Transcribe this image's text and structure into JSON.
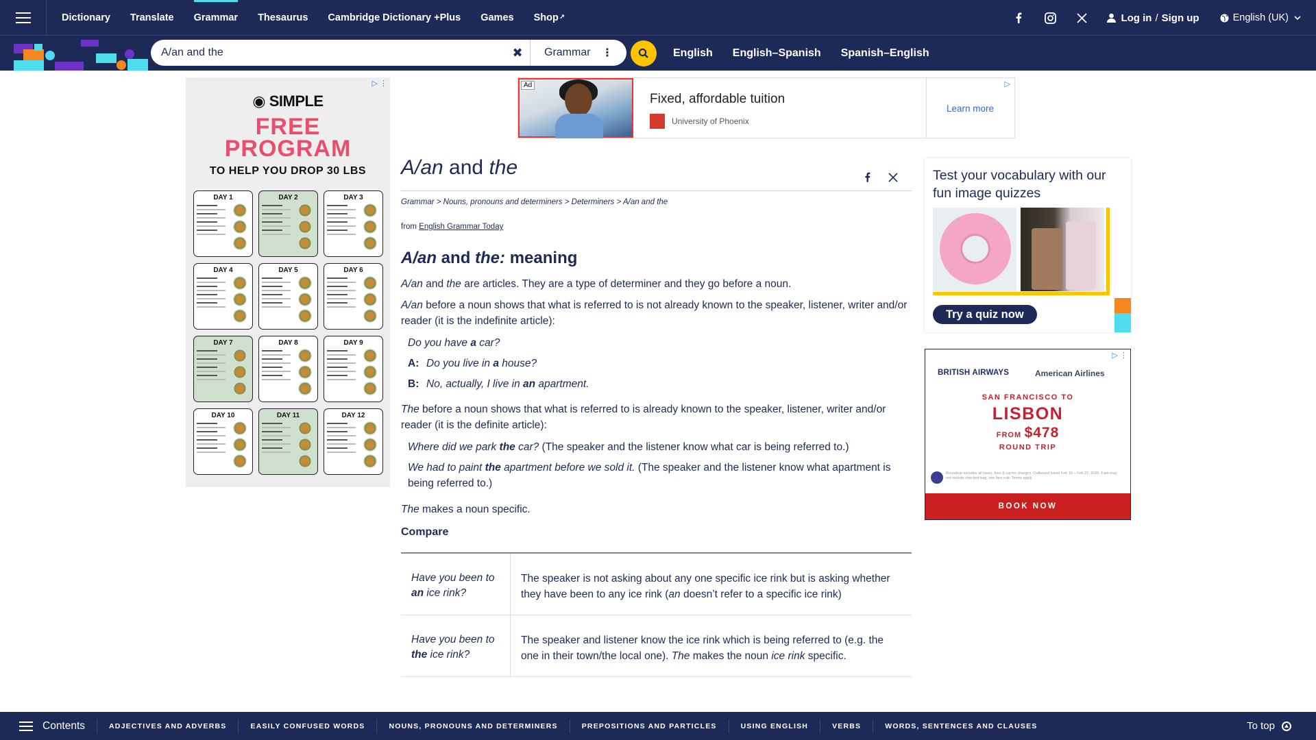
{
  "topnav": {
    "links": [
      {
        "label": "Dictionary"
      },
      {
        "label": "Translate"
      },
      {
        "label": "Grammar",
        "active": true
      },
      {
        "label": "Thesaurus"
      },
      {
        "label": "Cambridge Dictionary +Plus"
      },
      {
        "label": "Games"
      },
      {
        "label": "Shop"
      }
    ],
    "social": [
      "facebook-icon",
      "instagram-icon",
      "x-icon"
    ],
    "login_label": "Log in",
    "signup_label": "Sign up",
    "login_sep": "/",
    "language": "English (UK)"
  },
  "search": {
    "query": "A/an and the",
    "scope": "Grammar",
    "dictionaries": [
      "English",
      "English–Spanish",
      "Spanish–English"
    ]
  },
  "colors": {
    "navy": "#1d2a57",
    "accent_yellow": "#fec400",
    "accent_cyan": "#4fdcec",
    "accent_orange": "#f6861f",
    "accent_purple": "#6c33c6"
  },
  "left_ad": {
    "brand": "SIMPLE",
    "headline_1": "FREE",
    "headline_2": "PROGRAM",
    "subline": "TO HELP YOU DROP 30 LBS",
    "days": [
      "DAY 1",
      "DAY 2",
      "DAY 3",
      "DAY 4",
      "DAY 5",
      "DAY 6",
      "DAY 7",
      "DAY 8",
      "DAY 9",
      "DAY 10",
      "DAY 11",
      "DAY 12"
    ]
  },
  "top_ad": {
    "tag": "Ad",
    "headline": "Fixed, affordable tuition",
    "sponsor": "University of Phoenix",
    "cta": "Learn more"
  },
  "article": {
    "title_em1": "A/an",
    "title_mid": " and ",
    "title_em2": "the",
    "breadcrumb": "Grammar > Nouns, pronouns and determiners > Determiners > A/an and the",
    "from_label": "from ",
    "from_link": "English Grammar Today",
    "h2_em": "A/an",
    "h2_mid": " and ",
    "h2_em2": "the:",
    "h2_rest": " meaning",
    "p1_em1": "A/an",
    "p1_mid": " and ",
    "p1_em2": "the",
    "p1_rest": " are articles. They are a type of determiner and they go before a noun.",
    "p2_em": "A/an",
    "p2_rest": " before a noun shows that what is referred to is not already known to the speaker, listener, writer and/or reader (it is the indefinite article):",
    "ex1_a": "Do you have ",
    "ex1_b": "a",
    "ex1_c": " car?",
    "ex2_spk": "A:",
    "ex2_a": "Do you live in ",
    "ex2_b": "a",
    "ex2_c": " house?",
    "ex3_spk": "B:",
    "ex3_a": "No, actually, I live in ",
    "ex3_b": "an",
    "ex3_c": " apartment.",
    "p3_em": "The",
    "p3_rest": " before a noun shows that what is referred to is already known to the speaker, listener, writer and/or reader (it is the definite article):",
    "ex4_a": "Where did we park ",
    "ex4_b": "the",
    "ex4_c": " car?",
    "ex4_note": " (The speaker and the listener know what car is being referred to.)",
    "ex5_a": "We had to paint ",
    "ex5_b": "the",
    "ex5_c": " apartment before we sold it.",
    "ex5_note": " (The speaker and the listener know what apartment is being referred to.)",
    "p4_em": "The",
    "p4_rest": " makes a noun specific.",
    "compare": "Compare",
    "table": [
      {
        "q_a": "Have you been to ",
        "q_b": "an",
        "q_c": " ice rink?",
        "exp_a": "The speaker is not asking about any one specific ice rink but is asking whether they have been to any ice rink (",
        "exp_em": "an",
        "exp_b": " doesn’t refer to a specific ice rink)"
      },
      {
        "q_a": "Have you been to ",
        "q_b": "the",
        "q_c": " ice rink?",
        "exp_a": "The speaker and listener know the ice rink which is being referred to (e.g. the one in their town/the local one). ",
        "exp_em": "The",
        "exp_b": " makes the noun ",
        "exp_em2": "ice rink",
        "exp_c": " specific."
      }
    ]
  },
  "quiz": {
    "text": "Test your vocabulary with our fun image quizzes",
    "button": "Try a quiz now"
  },
  "ba_ad": {
    "brand1": "BRITISH AIRWAYS",
    "brand2": "American Airlines",
    "route": "SAN FRANCISCO TO",
    "city": "LISBON",
    "from": "FROM",
    "price": "$478",
    "trip": "ROUND TRIP",
    "fine": "Roundtrip includes all taxes, fees & carrier charges. Outbound travel Feb 15 – Feb 27, 2026. Fare may not include checked bag, see fare rule. Terms apply.",
    "cta": "BOOK NOW"
  },
  "bottombar": {
    "contents": "Contents",
    "categories": [
      "ADJECTIVES AND ADVERBS",
      "EASILY CONFUSED WORDS",
      "NOUNS, PRONOUNS AND DETERMINERS",
      "PREPOSITIONS AND PARTICLES",
      "USING ENGLISH",
      "VERBS",
      "WORDS, SENTENCES AND CLAUSES"
    ],
    "to_top": "To top"
  }
}
